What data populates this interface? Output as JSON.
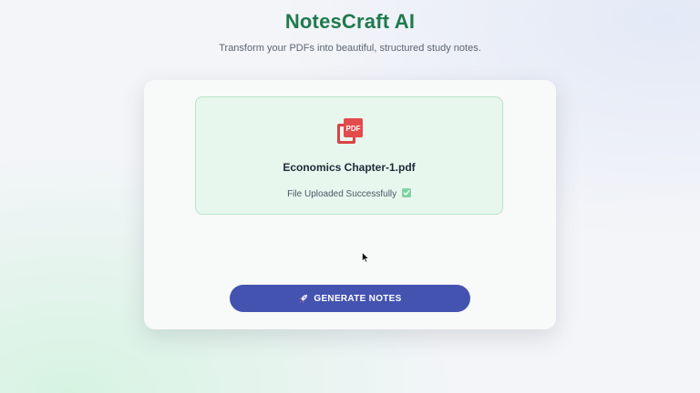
{
  "header": {
    "title": "NotesCraft AI",
    "subtitle": "Transform your PDFs into beautiful, structured study notes."
  },
  "upload": {
    "icon": "pdf-file-icon",
    "icon_text": "PDF",
    "file_name": "Economics Chapter-1.pdf",
    "status": "File Uploaded Successfully",
    "status_icon": "check-mark-icon"
  },
  "actions": {
    "generate_icon": "rocket-icon",
    "generate_label": "GENERATE NOTES"
  },
  "colors": {
    "title": "#1f7a4d",
    "upload_bg": "#e8f7ee",
    "upload_border": "#b8e3c8",
    "button": "#4453b0",
    "pdf_icon": "#e24b4b"
  }
}
